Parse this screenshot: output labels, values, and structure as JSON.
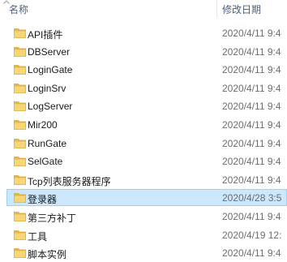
{
  "header": {
    "name_label": "名称",
    "date_label": "修改日期"
  },
  "rows": [
    {
      "name": "API插件",
      "date": "2020/4/11 9:4"
    },
    {
      "name": "DBServer",
      "date": "2020/4/11 9:4"
    },
    {
      "name": "LoginGate",
      "date": "2020/4/11 9:4"
    },
    {
      "name": "LoginSrv",
      "date": "2020/4/11 9:4"
    },
    {
      "name": "LogServer",
      "date": "2020/4/11 9:4"
    },
    {
      "name": "Mir200",
      "date": "2020/4/11 9:4"
    },
    {
      "name": "RunGate",
      "date": "2020/4/11 9:4"
    },
    {
      "name": "SelGate",
      "date": "2020/4/11 9:4"
    },
    {
      "name": "Tcp列表服务器程序",
      "date": "2020/4/11 9:4"
    },
    {
      "name": "登录器",
      "date": "2020/4/28 3:5",
      "selected": true
    },
    {
      "name": "第三方补丁",
      "date": "2020/4/11 9:4"
    },
    {
      "name": "工具",
      "date": "2020/4/19 12:"
    },
    {
      "name": "脚本实例",
      "date": "2020/4/11 9:4"
    }
  ],
  "colors": {
    "folder": "#f7d675",
    "selection": "#cce8ff",
    "selection_border": "#99d1ff"
  }
}
